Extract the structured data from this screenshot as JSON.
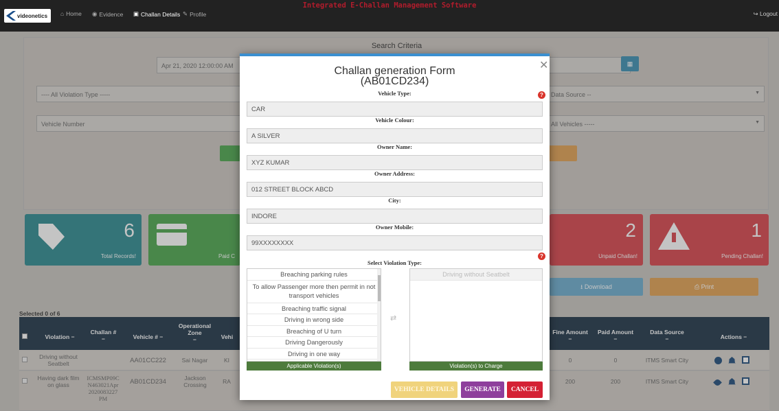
{
  "nav": {
    "logo": "videonetics",
    "items": [
      {
        "label": "Home",
        "icon": "home-icon"
      },
      {
        "label": "Evidence",
        "icon": "evidence-icon"
      },
      {
        "label": "Challan Details",
        "icon": "challan-icon"
      },
      {
        "label": "Profile",
        "icon": "profile-icon"
      }
    ],
    "app_title": "Integrated E-Challan Management Software",
    "logout": "Logout"
  },
  "search": {
    "title": "Search Criteria",
    "date_from": "Apr 21, 2020 12:00:00 AM",
    "violation_type": "---- All Violation Type -----",
    "data_source": "Data Source --",
    "vehicle_number_placeholder": "Vehicle Number",
    "vehicles": "All Vehicles -----"
  },
  "stats": [
    {
      "value": "6",
      "label": "Total Records!",
      "color": "#2b8a8f"
    },
    {
      "value": "",
      "label": "Paid C",
      "color": "#4aa64c"
    },
    {
      "value": "2",
      "label": "Unpaid Challan!",
      "color": "#d8434a"
    },
    {
      "value": "1",
      "label": "Pending Challan!",
      "color": "#d8434a"
    }
  ],
  "actions": {
    "download": "Download",
    "print": "Print"
  },
  "table": {
    "selected": "Selected 0 of 6",
    "headers": [
      "Violation",
      "Challan #",
      "Vehicle #",
      "Operational Zone",
      "Vehi",
      "Fine Amount",
      "Paid Amount",
      "Data Source",
      "Actions"
    ],
    "rows": [
      {
        "violation": "Driving without Seatbelt",
        "challan": "",
        "vehicle": "AA01CC222",
        "zone": "Sai Nagar",
        "vehi": "KI",
        "fine": "0",
        "paid": "0",
        "source": "ITMS Smart City"
      },
      {
        "violation": "Having dark film on glass",
        "challan": "ICMSMP09C N463021Apr 2020083227 PM",
        "vehicle": "AB01CD234",
        "zone": "Jackson Crossing",
        "vehi": "RA",
        "fine": "200",
        "paid": "200",
        "source": "ITMS Smart City"
      }
    ]
  },
  "modal": {
    "title": "Challan generation Form",
    "subtitle": "(AB01CD234)",
    "fields": [
      {
        "label": "Vehicle Type:",
        "value": "CAR"
      },
      {
        "label": "Vehicle Colour:",
        "value": "A SILVER"
      },
      {
        "label": "Owner Name:",
        "value": "XYZ KUMAR"
      },
      {
        "label": "Owner Address:",
        "value": "012 STREET BLOCK ABCD"
      },
      {
        "label": "City:",
        "value": "INDORE"
      },
      {
        "label": "Owner Mobile:",
        "value": "99XXXXXXXX"
      }
    ],
    "violation_label": "Select Violation Type:",
    "applicable": [
      "Breaching parking rules",
      "To allow Passenger more then permit in not transport vehicles",
      "Breaching traffic signal",
      "Driving in wrong side",
      "Breaching of U turn",
      "Driving Dangerously",
      "Driving in one way"
    ],
    "applicable_footer": "Applicable Violation(s)",
    "charged": [
      "Driving without Seatbelt"
    ],
    "charged_footer": "Violation(s) to Charge",
    "buttons": {
      "details": "VEHICLE DETAILS",
      "generate": "GENERATE",
      "cancel": "CANCEL"
    }
  }
}
